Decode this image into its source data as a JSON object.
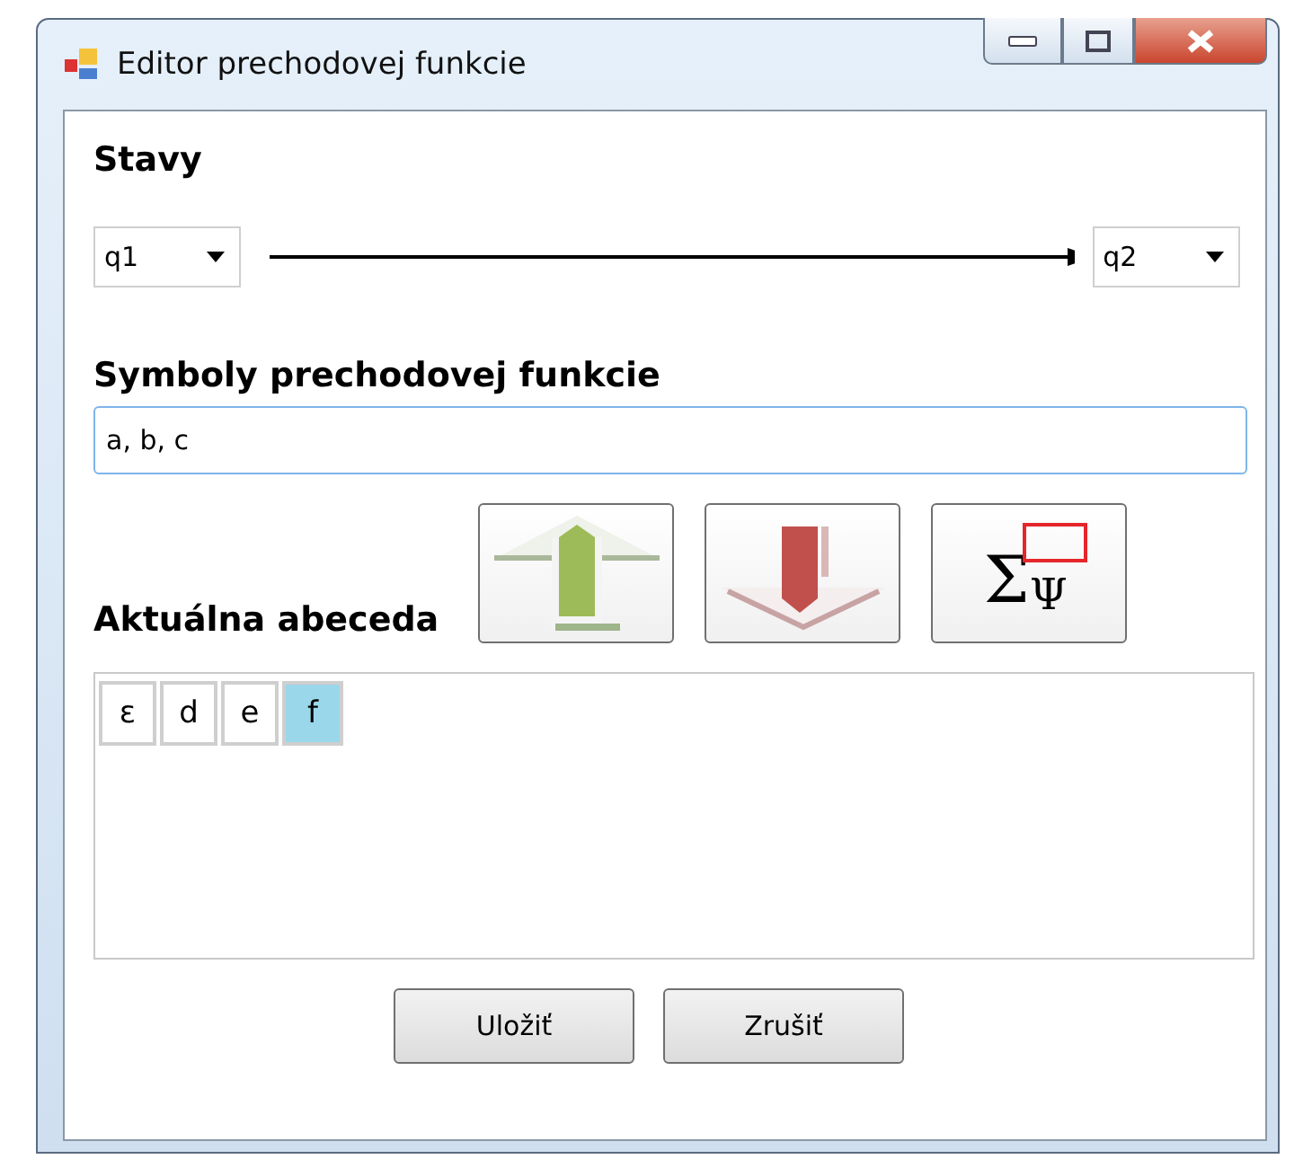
{
  "window": {
    "title": "Editor prechodovej funkcie"
  },
  "states": {
    "heading": "Stavy",
    "from": "q1",
    "to": "q2"
  },
  "symbols": {
    "heading": "Symboly prechodovej funkcie",
    "value": "a, b, c"
  },
  "alphabet": {
    "heading": "Aktuálna abeceda",
    "tools": [
      {
        "kind": "up"
      },
      {
        "kind": "down"
      },
      {
        "kind": "sigma",
        "symbol": "Σ",
        "subscript": "Ψ"
      }
    ],
    "items": [
      {
        "label": "ε",
        "selected": false
      },
      {
        "label": "d",
        "selected": false
      },
      {
        "label": "e",
        "selected": false
      },
      {
        "label": "f",
        "selected": true
      }
    ]
  },
  "buttons": [
    "Uložiť",
    "Zrušiť"
  ]
}
